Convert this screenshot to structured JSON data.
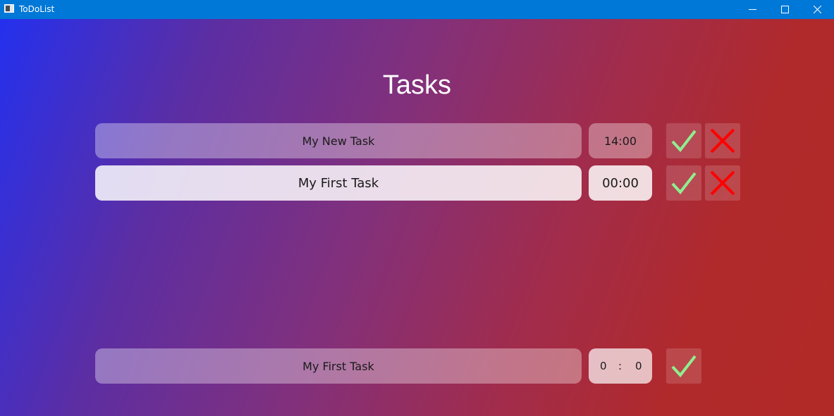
{
  "window": {
    "title": "ToDoList"
  },
  "page": {
    "title": "Tasks"
  },
  "tasks": [
    {
      "name": "My New Task",
      "time": "14:00"
    },
    {
      "name": "My First Task",
      "time": "00:00"
    }
  ],
  "new_task": {
    "name": "My First Task",
    "hour": "0",
    "separator": ":",
    "minute": "0"
  },
  "colors": {
    "titlebar": "#0078d7",
    "gradient_start": "#2430ee",
    "gradient_end": "#b22a27",
    "check": "#90ee90",
    "cross": "#ff0000"
  },
  "icons": {
    "complete": "check-icon",
    "delete": "cross-icon"
  }
}
